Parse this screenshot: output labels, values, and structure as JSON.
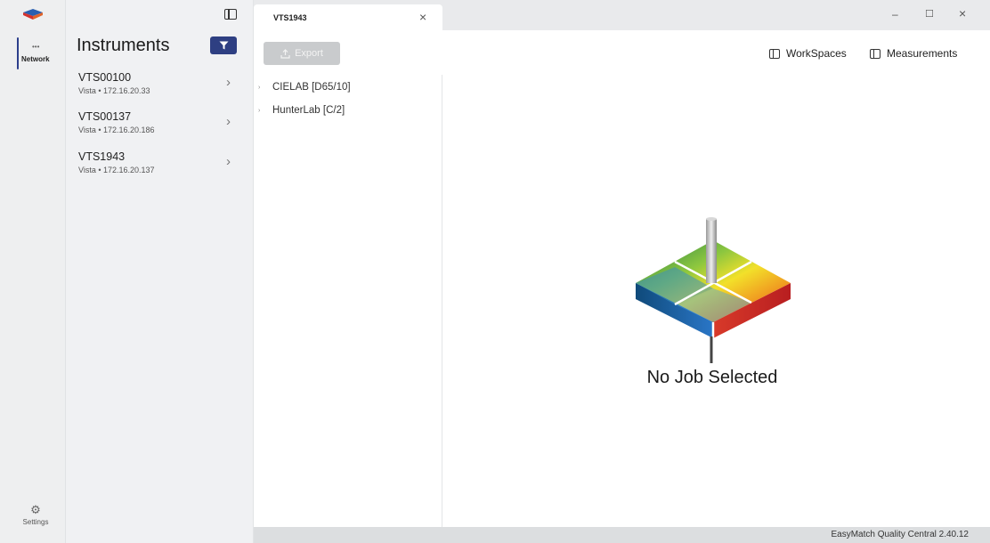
{
  "rail": {
    "network_label": "Network",
    "settings_label": "Settings"
  },
  "instruments": {
    "title": "Instruments",
    "items": [
      {
        "name": "VTS00100",
        "sub": "Vista • 172.16.20.33"
      },
      {
        "name": "VTS00137",
        "sub": "Vista • 172.16.20.186"
      },
      {
        "name": "VTS1943",
        "sub": "Vista • 172.16.20.137"
      }
    ]
  },
  "tab": {
    "label": "VTS1943",
    "close": "×"
  },
  "window": {
    "minimize": "–",
    "maximize": "☐",
    "close": "×"
  },
  "toolbar": {
    "export_label": "Export",
    "workspaces_label": "WorkSpaces",
    "measurements_label": "Measurements"
  },
  "tree": {
    "items": [
      {
        "label": "CIELAB [D65/10]"
      },
      {
        "label": "HunterLab [C/2]"
      }
    ]
  },
  "main": {
    "empty_title": "No Job Selected"
  },
  "status": {
    "version": "EasyMatch Quality Central 2.40.12"
  },
  "colors": {
    "accent": "#2e3f82",
    "export_disabled": "#c9cbcd"
  }
}
